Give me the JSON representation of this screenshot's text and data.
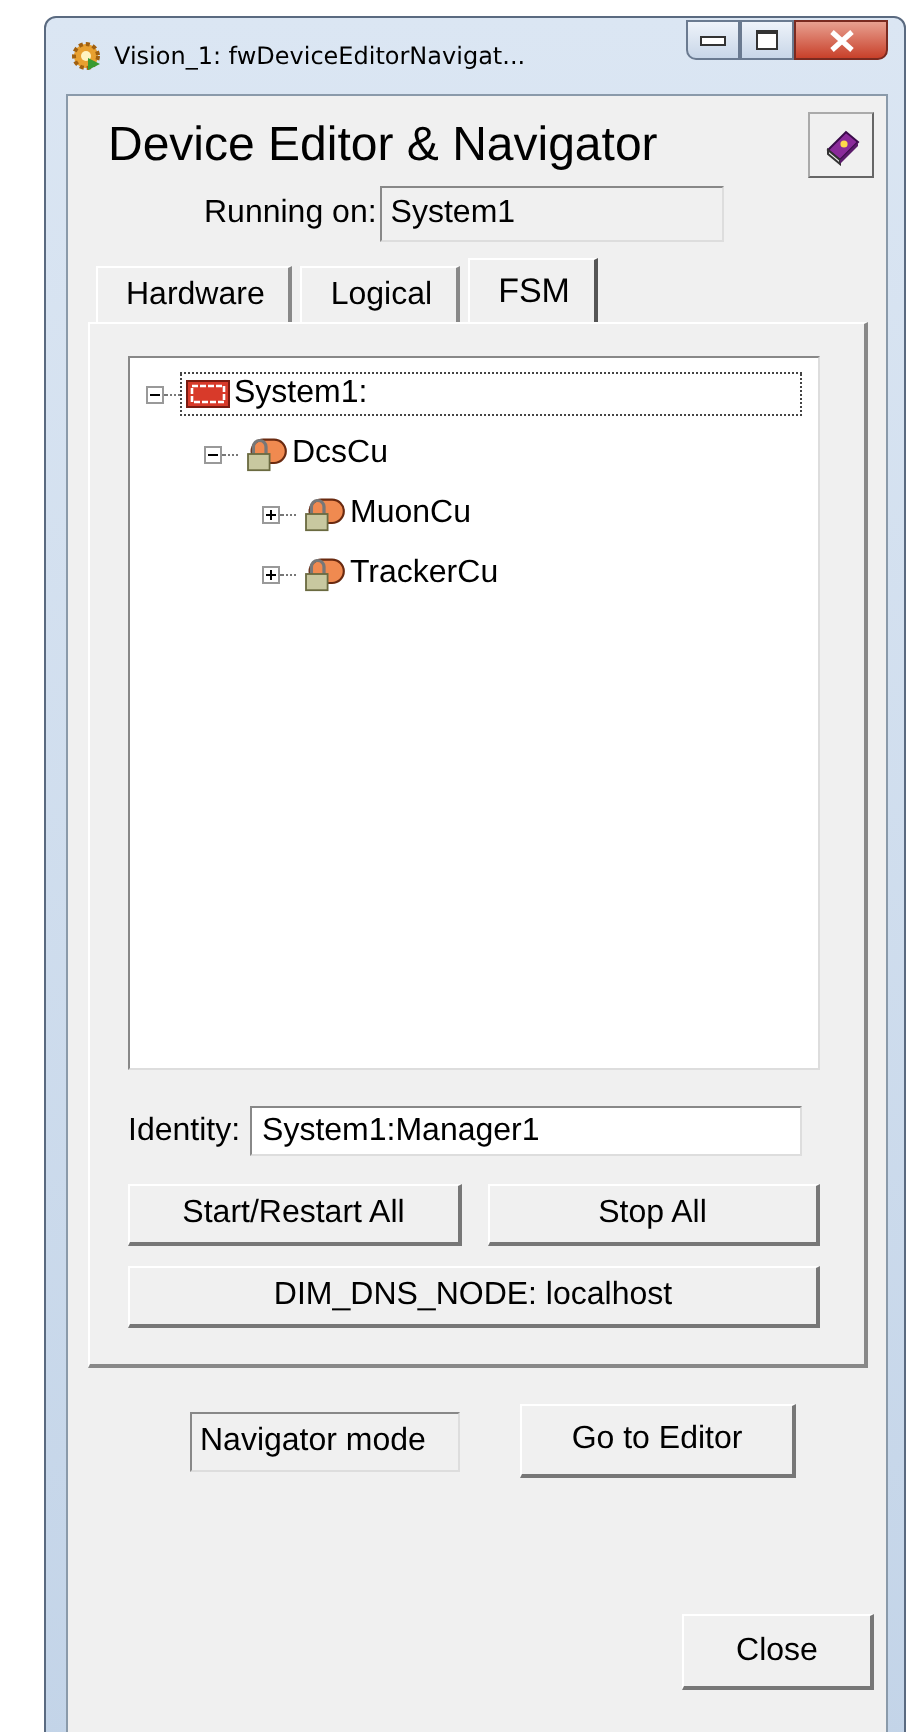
{
  "window": {
    "title": "Vision_1: fwDeviceEditorNavigat..."
  },
  "header": {
    "title": "Device Editor & Navigator"
  },
  "running_on": {
    "label": "Running on:",
    "value": "System1"
  },
  "tabs": [
    {
      "label": "Hardware",
      "selected": false
    },
    {
      "label": "Logical",
      "selected": false
    },
    {
      "label": "FSM",
      "selected": true
    }
  ],
  "tree": [
    {
      "label": "System1:",
      "kind": "system",
      "expanded": true,
      "selected": true,
      "children": [
        {
          "label": "DcsCu",
          "kind": "cu",
          "expanded": true,
          "selected": false,
          "children": [
            {
              "label": "MuonCu",
              "kind": "cu",
              "expanded": false,
              "selected": false
            },
            {
              "label": "TrackerCu",
              "kind": "cu",
              "expanded": false,
              "selected": false
            }
          ]
        }
      ]
    }
  ],
  "identity": {
    "label": "Identity:",
    "value": "System1:Manager1"
  },
  "buttons": [
    "Start/Restart All",
    "Stop All"
  ],
  "dns_button": "DIM_DNS_NODE: localhost",
  "mode": {
    "value": "Navigator mode"
  },
  "editor_button": "Go to Editor",
  "close_button": "Close"
}
